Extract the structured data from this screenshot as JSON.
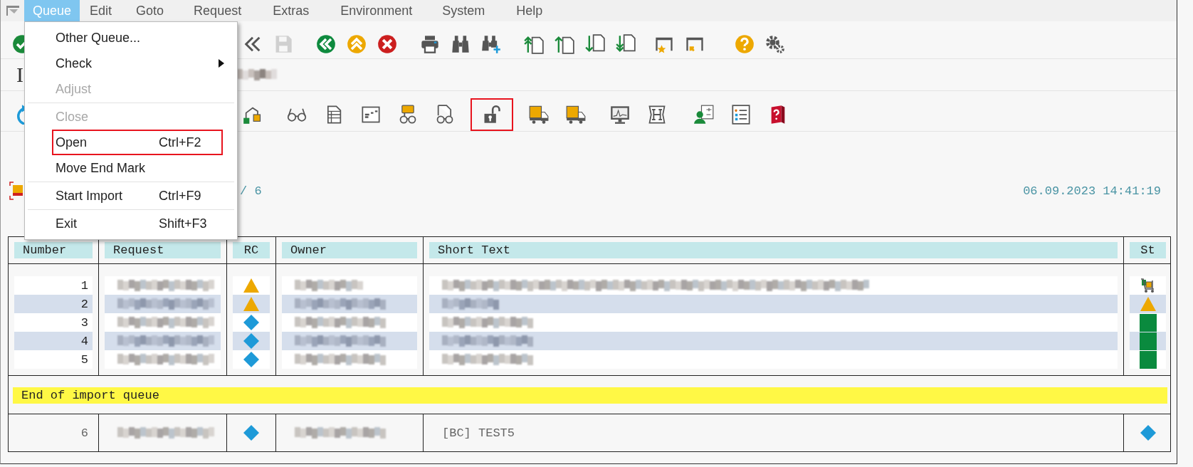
{
  "menubar": [
    {
      "label": "Queue",
      "selected": true
    },
    {
      "label": "Edit",
      "selected": false
    },
    {
      "label": "Goto",
      "selected": false
    },
    {
      "label": "Request",
      "selected": false
    },
    {
      "label": "Extras",
      "selected": false
    },
    {
      "label": "Environment",
      "selected": false
    },
    {
      "label": "System",
      "selected": false
    },
    {
      "label": "Help",
      "selected": false
    }
  ],
  "menu": [
    {
      "kind": "item",
      "label": "Other Queue...",
      "disabled": false,
      "submenu": false,
      "highlighted": false
    },
    {
      "kind": "item",
      "label": "Check",
      "disabled": false,
      "submenu": true,
      "highlighted": false
    },
    {
      "kind": "item",
      "label": "Adjust",
      "disabled": true,
      "submenu": false,
      "highlighted": false
    },
    {
      "kind": "separator"
    },
    {
      "kind": "item",
      "label": "Close",
      "disabled": true,
      "submenu": false,
      "highlighted": false
    },
    {
      "kind": "item",
      "label": "Open",
      "shortcut": "Ctrl+F2",
      "disabled": false,
      "submenu": false,
      "highlighted": true
    },
    {
      "kind": "item",
      "label": "Move End Mark",
      "disabled": false,
      "submenu": false,
      "highlighted": false
    },
    {
      "kind": "separator"
    },
    {
      "kind": "item",
      "label": "Start Import",
      "shortcut": "Ctrl+F9",
      "disabled": false,
      "submenu": false,
      "highlighted": false
    },
    {
      "kind": "separator"
    },
    {
      "kind": "item",
      "label": "Exit",
      "shortcut": "Shift+F3",
      "disabled": false,
      "submenu": false,
      "highlighted": false
    }
  ],
  "toolbar": [
    [
      {
        "kind": "confirm"
      }
    ],
    [
      {
        "kind": "back"
      },
      {
        "kind": "save",
        "disabled": true
      }
    ],
    [
      {
        "kind": "nav-back"
      },
      {
        "kind": "nav-up"
      },
      {
        "kind": "cancel"
      }
    ],
    [
      {
        "kind": "print"
      },
      {
        "kind": "find"
      },
      {
        "kind": "find-next"
      }
    ],
    [
      {
        "kind": "page-up-all"
      },
      {
        "kind": "page-up"
      },
      {
        "kind": "page-down"
      },
      {
        "kind": "page-down-all"
      }
    ],
    [
      {
        "kind": "window-star"
      },
      {
        "kind": "window-arrow"
      }
    ],
    [
      {
        "kind": "help"
      },
      {
        "kind": "settings"
      }
    ]
  ],
  "title": "I",
  "app_toolbar": [
    [
      {
        "kind": "refresh",
        "highlighted": false
      }
    ],
    [
      {
        "kind": "hierarchy",
        "highlighted": false
      }
    ],
    [
      {
        "kind": "glasses",
        "highlighted": false
      },
      {
        "kind": "list-doc",
        "highlighted": false
      },
      {
        "kind": "layout",
        "highlighted": false
      },
      {
        "kind": "comment-glasses",
        "highlighted": false
      },
      {
        "kind": "doc-glasses",
        "highlighted": false
      },
      {
        "kind": "unlock",
        "highlighted": true
      },
      {
        "kind": "truck",
        "highlighted": false
      },
      {
        "kind": "truck",
        "highlighted": false
      }
    ],
    [
      {
        "kind": "monitor",
        "highlighted": false
      },
      {
        "kind": "h-scroll",
        "highlighted": false
      }
    ],
    [
      {
        "kind": "person",
        "highlighted": false
      },
      {
        "kind": "checklist",
        "highlighted": false
      },
      {
        "kind": "help-book",
        "highlighted": false
      }
    ]
  ],
  "info": {
    "counter": "/ 6",
    "timestamp": "06.09.2023 14:41:19"
  },
  "table": {
    "columns": [
      "Number",
      "Request",
      "RC",
      "Owner",
      "Short Text",
      "St"
    ],
    "rows": [
      {
        "number": "1",
        "rc": {
          "kind": "warning"
        },
        "st": {
          "kind": "transport"
        }
      },
      {
        "number": "2",
        "rc": {
          "kind": "warning"
        },
        "st": {
          "kind": "warning"
        }
      },
      {
        "number": "3",
        "rc": {
          "kind": "info"
        },
        "st": {
          "kind": "ok"
        }
      },
      {
        "number": "4",
        "rc": {
          "kind": "info"
        },
        "st": {
          "kind": "ok"
        }
      },
      {
        "number": "5",
        "rc": {
          "kind": "info"
        },
        "st": {
          "kind": "ok"
        }
      }
    ],
    "end_marker": "End of import queue",
    "after_rows": [
      {
        "number": "6",
        "rc": {
          "kind": "info"
        },
        "short_text": "[BC] TEST5",
        "st": {
          "kind": "info"
        }
      }
    ]
  }
}
